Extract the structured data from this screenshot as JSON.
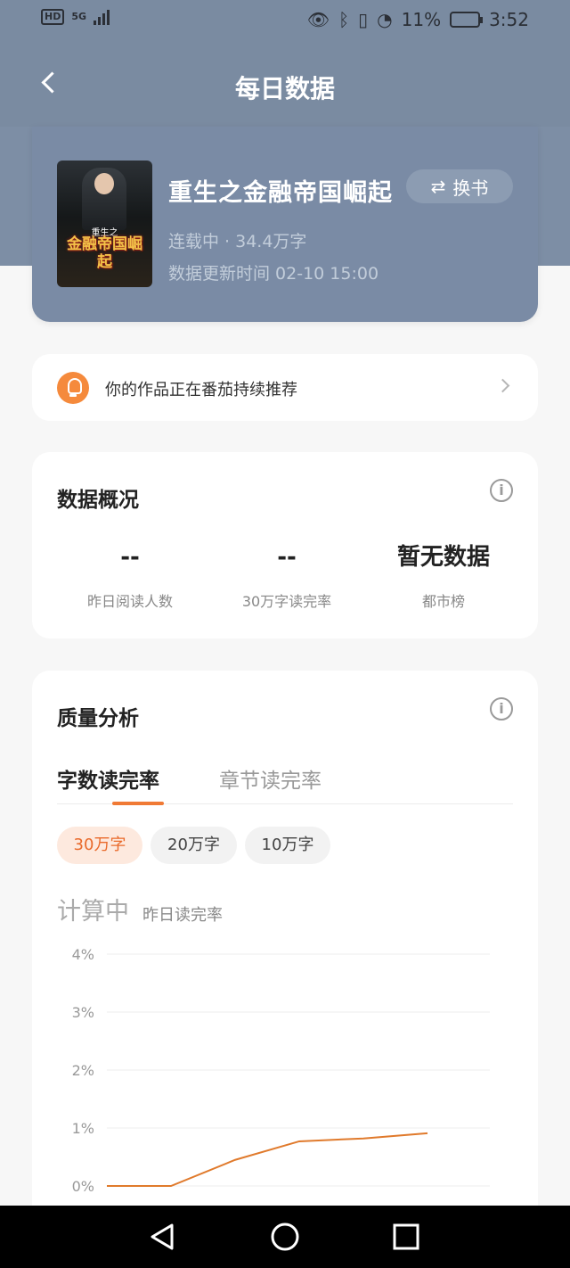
{
  "status_bar": {
    "left_badge": "HD",
    "network": "5G",
    "battery_percent": "11%",
    "time": "3:52"
  },
  "nav": {
    "title": "每日数据"
  },
  "book": {
    "title": "重生之金融帝国崛起",
    "swap_label": "换书",
    "meta": "连载中 · 34.4万字",
    "updated": "数据更新时间 02-10 15:00",
    "cover_title": "金融帝国崛起",
    "cover_subtitle": "重生之"
  },
  "recommend": {
    "text": "你的作品正在番茄持续推荐"
  },
  "overview": {
    "title": "数据概况",
    "info_glyph": "i",
    "stats": [
      {
        "value": "--",
        "label": "昨日阅读人数"
      },
      {
        "value": "--",
        "label": "30万字读完率"
      },
      {
        "value": "暂无数据",
        "label": "都市榜"
      }
    ]
  },
  "quality": {
    "title": "质量分析",
    "info_glyph": "i",
    "tabs": [
      {
        "label": "字数读完率",
        "active": true
      },
      {
        "label": "章节读完率",
        "active": false
      }
    ],
    "chips": [
      {
        "label": "30万字",
        "active": true
      },
      {
        "label": "20万字",
        "active": false
      },
      {
        "label": "10万字",
        "active": false
      }
    ],
    "status": "计算中",
    "status_sub": "昨日读完率"
  },
  "chart_data": {
    "type": "line",
    "y_ticks": [
      "4%",
      "3%",
      "2%",
      "1%",
      "0%"
    ],
    "ylim": [
      0,
      4
    ],
    "series": [
      {
        "values": [
          0,
          0,
          0.45,
          0.77,
          0.82,
          0.91
        ]
      }
    ],
    "line_color": "#e07a2c",
    "grid": true
  },
  "colors": {
    "header": "#7a8ba1",
    "accent": "#f07a35"
  }
}
